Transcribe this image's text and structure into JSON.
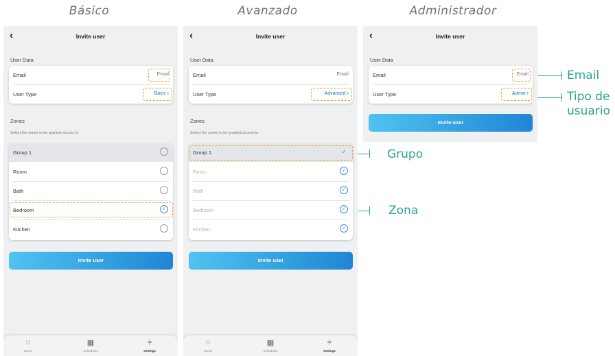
{
  "columns": [
    "Básico",
    "Avanzado",
    "Administrador"
  ],
  "screen": {
    "back": "‹",
    "title": "Invite user",
    "user_data_label": "User Data",
    "email_label": "Email",
    "email_value": "Email",
    "user_type_label": "User Type",
    "zones_label": "Zones",
    "zones_hint": "Select the zones to be granted access to",
    "group": "Group 1",
    "zones": [
      "Room",
      "Bath",
      "Bedroom",
      "Kitchen"
    ],
    "invite_button": "Invite user"
  },
  "user_types": {
    "basic": "Basic",
    "advanced": "Advanced",
    "admin": "Admin"
  },
  "chevron": "›",
  "tabs": [
    {
      "label": "Zones",
      "icon": "zones-grid-icon"
    },
    {
      "label": "Schedules",
      "icon": "calendar-icon"
    },
    {
      "label": "Settings",
      "icon": "sliders-icon"
    }
  ],
  "annotations": {
    "email": "Email",
    "user_type_line1": "Tipo de",
    "user_type_line2": "usuario",
    "group": "Grupo",
    "zone": "Zona"
  },
  "colors": {
    "accent": "#1a75c5",
    "dash_highlight": "#f0a030",
    "annotation": "#2aa58f",
    "button_start": "#4fc3f1",
    "button_end": "#2086d4"
  }
}
